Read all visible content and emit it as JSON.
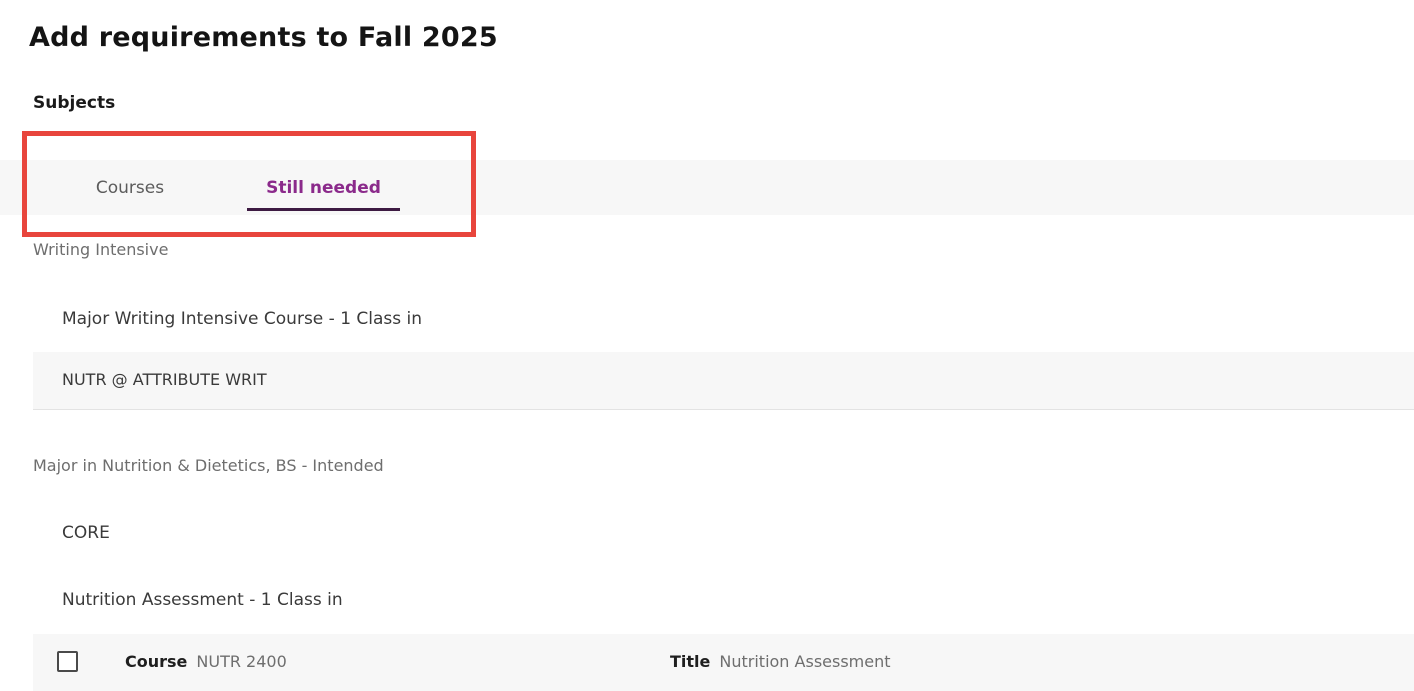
{
  "page": {
    "title": "Add requirements to Fall 2025",
    "section_label": "Subjects"
  },
  "tabs": {
    "courses_label": "Courses",
    "still_needed_label": "Still needed",
    "active": "Still needed",
    "active_color": "#8b2a8b",
    "inactive_color": "#5c5c5c",
    "underline_color": "#3d1a42"
  },
  "annotation": {
    "color": "#e8453c"
  },
  "groups": [
    {
      "heading": "Writing Intensive",
      "requirement": "Major Writing Intensive Course - 1 Class in",
      "attribute_row": "NUTR @ ATTRIBUTE WRIT"
    },
    {
      "heading": "Major in Nutrition & Dietetics, BS - Intended",
      "sub_heading": "CORE",
      "requirement": "Nutrition Assessment - 1 Class in",
      "course_row": {
        "checkbox_checked": false,
        "course_label": "Course",
        "course_value": "NUTR 2400",
        "title_label": "Title",
        "title_value": "Nutrition Assessment"
      }
    }
  ]
}
